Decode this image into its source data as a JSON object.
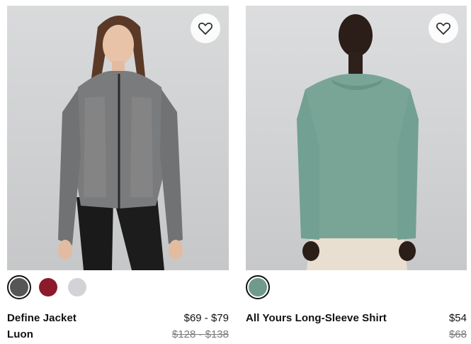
{
  "products": [
    {
      "name_line1": "Define Jacket",
      "name_line2": "Luon",
      "price": "$69 - $79",
      "original_price": "$128 - $138",
      "swatches": [
        {
          "color": "#555656",
          "selected": true
        },
        {
          "color": "#8c1a2a",
          "selected": false
        },
        {
          "color": "#d2d3d6",
          "selected": false
        }
      ],
      "image_icon": "product-photo-define-jacket"
    },
    {
      "name_line1": "All Yours Long-Sleeve Shirt",
      "price": "$54",
      "original_price": "$68",
      "swatches": [
        {
          "color": "#6f9a8d",
          "selected": true
        }
      ],
      "image_icon": "product-photo-all-yours-shirt"
    }
  ],
  "icons": {
    "favorite": "heart-outline-icon"
  }
}
